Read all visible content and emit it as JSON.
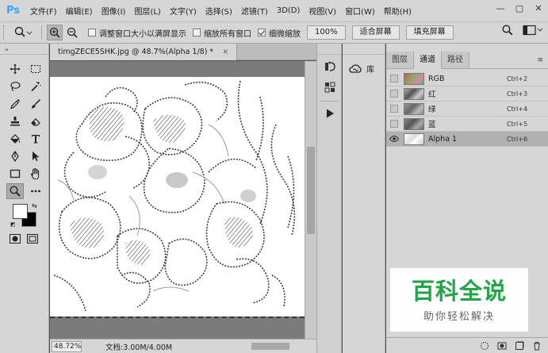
{
  "app": {
    "logo": "Ps"
  },
  "menu": [
    "文件(F)",
    "编辑(E)",
    "图像(I)",
    "图层(L)",
    "文字(Y)",
    "选择(S)",
    "滤镜(T)",
    "3D(D)",
    "视图(V)",
    "窗口(W)",
    "帮助(H)"
  ],
  "window_controls": {
    "minimize": "—",
    "restore": "▢",
    "close": "✕"
  },
  "options": {
    "resize_windows_label": "调整窗口大小以满屏显示",
    "resize_windows_checked": false,
    "zoom_all_label": "缩放所有窗口",
    "zoom_all_checked": false,
    "scrubby_zoom_label": "细微缩放",
    "scrubby_zoom_checked": true,
    "pct_button": "100%",
    "fit_screen_button": "适合屏幕",
    "fill_screen_button": "填充屏幕"
  },
  "document": {
    "tab_title": "timgZECE5SHK.jpg @ 48.7%(Alpha 1/8) *",
    "tab_close": "×"
  },
  "status": {
    "zoom": "48.72%",
    "doc_size": "文档:3.00M/4.00M"
  },
  "library": {
    "label": "库"
  },
  "panel": {
    "tabs": [
      "图层",
      "通道",
      "路径"
    ],
    "active_tab": "通道",
    "channels": [
      {
        "name": "RGB",
        "shortcut": "Ctrl+2",
        "visible": false,
        "selected": false
      },
      {
        "name": "红",
        "shortcut": "Ctrl+3",
        "visible": false,
        "selected": false
      },
      {
        "name": "绿",
        "shortcut": "Ctrl+4",
        "visible": false,
        "selected": false
      },
      {
        "name": "蓝",
        "shortcut": "Ctrl+5",
        "visible": false,
        "selected": false
      },
      {
        "name": "Alpha 1",
        "shortcut": "Ctrl+6",
        "visible": true,
        "selected": true
      }
    ]
  },
  "watermark": {
    "main": "百科全说",
    "sub": "助你轻松解决"
  },
  "colors": {
    "accent": "#31a8ff",
    "watermark_green": "#21a545",
    "chrome": "#d6d6d6"
  }
}
